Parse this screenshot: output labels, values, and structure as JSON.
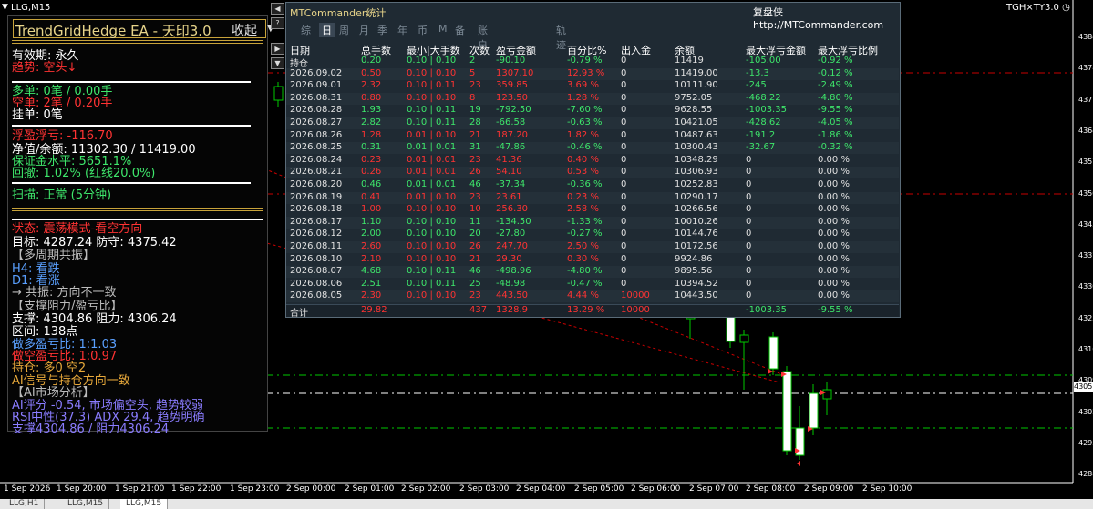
{
  "window": {
    "symbol_title": "LLG,M15",
    "right_indicator": "TGH×TY3.0"
  },
  "ea_panel": {
    "title": "TrendGridHedge EA - 天印3.0",
    "collapse_label": "收起",
    "lines": [
      {
        "text": "有效期: 永久",
        "color": "#ffffff"
      },
      {
        "text": "趋势: 空头↓",
        "color": "#ff3333"
      },
      {
        "text": "多单: 0笔 / 0.00手",
        "color": "#3ee66b"
      },
      {
        "text": "空单: 2笔 / 0.20手",
        "color": "#ff3333"
      },
      {
        "text": "挂单: 0笔",
        "color": "#ffffff"
      },
      {
        "text": "浮盈浮亏: -116.70",
        "color": "#ff3333"
      },
      {
        "text": "净值/余额: 11302.30 / 11419.00",
        "color": "#ffffff"
      },
      {
        "text": "保证金水平: 5651.1%",
        "color": "#3ee66b"
      },
      {
        "text": "回撤: 1.02% (红线20.0%)",
        "color": "#3ee66b"
      },
      {
        "text": "扫描: 正常 (5分钟)",
        "color": "#3ee66b"
      },
      {
        "text": "状态: 震荡模式-看空方向",
        "color": "#ff3333"
      },
      {
        "text": "目标: 4287.24  防守: 4375.42",
        "color": "#ffffff"
      },
      {
        "text": "【多周期共振】",
        "color": "#bbbbbb"
      },
      {
        "text": "H4: 看跌",
        "color": "#5aa0ff"
      },
      {
        "text": "D1: 看涨",
        "color": "#5aa0ff"
      },
      {
        "text": "→ 共振: 方向不一致",
        "color": "#bbbbbb"
      },
      {
        "text": "【支撑阻力/盈亏比】",
        "color": "#bbbbbb"
      },
      {
        "text": "支撑: 4304.86  阻力: 4306.24",
        "color": "#ffffff"
      },
      {
        "text": "区间: 138点",
        "color": "#ffffff"
      },
      {
        "text": "做多盈亏比: 1:1.03",
        "color": "#5aa0ff"
      },
      {
        "text": "做空盈亏比: 1:0.97",
        "color": "#ff3333"
      },
      {
        "text": "持仓: 多0 空2",
        "color": "#e7a83a"
      },
      {
        "text": "AI信号与持仓方向一致",
        "color": "#e7a83a"
      },
      {
        "text": "【AI市场分析】",
        "color": "#bbbbbb"
      },
      {
        "text": "AI评分 -0.54, 市场偏空头, 趋势较弱",
        "color": "#8a7cff"
      },
      {
        "text": "RSI中性(37.3)  ADX 29.4, 趋势明确",
        "color": "#8a7cff"
      },
      {
        "text": "支撑4304.86 / 阻力4306.24",
        "color": "#8a7cff"
      }
    ]
  },
  "side_buttons": [
    "◀",
    "?",
    "▶",
    "▼"
  ],
  "stats": {
    "title": "MTCommander统计",
    "brand": "复盘侠 http://MTCommander.com",
    "tabs": [
      "综",
      "日",
      "周",
      "月",
      "季",
      "年",
      "币",
      "M",
      "备",
      "账户",
      "轨迹"
    ],
    "active_tab": 1,
    "headers": [
      "日期",
      "总手数",
      "最小|大手数",
      "次数",
      "盈亏金额",
      "百分比%",
      "出入金",
      "余额",
      "最大浮亏金额",
      "最大浮亏比例"
    ],
    "rows": [
      [
        "持仓",
        "0.20",
        "0.10 | 0.10",
        "2",
        "-90.10",
        "-0.79 %",
        "0",
        "11419",
        "-105.00",
        "-0.92 %"
      ],
      [
        "2026.09.02",
        "0.50",
        "0.10 | 0.10",
        "5",
        "1307.10",
        "12.93 %",
        "0",
        "11419.00",
        "-13.3",
        "-0.12 %"
      ],
      [
        "2026.09.01",
        "2.32",
        "0.10 | 0.11",
        "23",
        "359.85",
        "3.69 %",
        "0",
        "10111.90",
        "-245",
        "-2.49 %"
      ],
      [
        "2026.08.31",
        "0.80",
        "0.10 | 0.10",
        "8",
        "123.50",
        "1.28 %",
        "0",
        "9752.05",
        "-468.22",
        "-4.80 %"
      ],
      [
        "2026.08.28",
        "1.93",
        "0.10 | 0.11",
        "19",
        "-792.50",
        "-7.60 %",
        "0",
        "9628.55",
        "-1003.35",
        "-9.55 %"
      ],
      [
        "2026.08.27",
        "2.82",
        "0.10 | 0.11",
        "28",
        "-66.58",
        "-0.63 %",
        "0",
        "10421.05",
        "-428.62",
        "-4.05 %"
      ],
      [
        "2026.08.26",
        "1.28",
        "0.01 | 0.10",
        "21",
        "187.20",
        "1.82 %",
        "0",
        "10487.63",
        "-191.2",
        "-1.86 %"
      ],
      [
        "2026.08.25",
        "0.31",
        "0.01 | 0.01",
        "31",
        "-47.86",
        "-0.46 %",
        "0",
        "10300.43",
        "-32.67",
        "-0.32 %"
      ],
      [
        "2026.08.24",
        "0.23",
        "0.01 | 0.01",
        "23",
        "41.36",
        "0.40 %",
        "0",
        "10348.29",
        "0",
        "0.00 %"
      ],
      [
        "2026.08.21",
        "0.26",
        "0.01 | 0.01",
        "26",
        "54.10",
        "0.53 %",
        "0",
        "10306.93",
        "0",
        "0.00 %"
      ],
      [
        "2026.08.20",
        "0.46",
        "0.01 | 0.01",
        "46",
        "-37.34",
        "-0.36 %",
        "0",
        "10252.83",
        "0",
        "0.00 %"
      ],
      [
        "2026.08.19",
        "0.41",
        "0.01 | 0.10",
        "23",
        "23.61",
        "0.23 %",
        "0",
        "10290.17",
        "0",
        "0.00 %"
      ],
      [
        "2026.08.18",
        "1.00",
        "0.10 | 0.10",
        "10",
        "256.30",
        "2.58 %",
        "0",
        "10266.56",
        "0",
        "0.00 %"
      ],
      [
        "2026.08.17",
        "1.10",
        "0.10 | 0.10",
        "11",
        "-134.50",
        "-1.33 %",
        "0",
        "10010.26",
        "0",
        "0.00 %"
      ],
      [
        "2026.08.12",
        "2.00",
        "0.10 | 0.10",
        "20",
        "-27.80",
        "-0.27 %",
        "0",
        "10144.76",
        "0",
        "0.00 %"
      ],
      [
        "2026.08.11",
        "2.60",
        "0.10 | 0.10",
        "26",
        "247.70",
        "2.50 %",
        "0",
        "10172.56",
        "0",
        "0.00 %"
      ],
      [
        "2026.08.10",
        "2.10",
        "0.10 | 0.10",
        "21",
        "29.30",
        "0.30 %",
        "0",
        "9924.86",
        "0",
        "0.00 %"
      ],
      [
        "2026.08.07",
        "4.68",
        "0.10 | 0.11",
        "46",
        "-498.96",
        "-4.80 %",
        "0",
        "9895.56",
        "0",
        "0.00 %"
      ],
      [
        "2026.08.06",
        "2.51",
        "0.10 | 0.11",
        "25",
        "-48.98",
        "-0.47 %",
        "0",
        "10394.52",
        "0",
        "0.00 %"
      ],
      [
        "2026.08.05",
        "2.30",
        "0.10 | 0.10",
        "23",
        "443.50",
        "4.44 %",
        "10000",
        "10443.50",
        "0",
        "0.00 %"
      ]
    ],
    "total": [
      "合计",
      "29.82",
      "",
      "437",
      "1328.9",
      "13.29 %",
      "10000",
      "",
      "-1003.35",
      "-9.55 %"
    ]
  },
  "x_axis": [
    "1 Sep 2026",
    "1 Sep 20:00",
    "1 Sep 21:00",
    "1 Sep 22:00",
    "1 Sep 23:00",
    "2 Sep 00:00",
    "2 Sep 01:00",
    "2 Sep 02:00",
    "2 Sep 03:00",
    "2 Sep 04:00",
    "2 Sep 05:00",
    "2 Sep 06:00",
    "2 Sep 07:00",
    "2 Sep 08:00",
    "2 Sep 09:00",
    "2 Sep 10:00"
  ],
  "y_axis": [
    "4384",
    "4378",
    "4371",
    "4364",
    "4357",
    "4350",
    "4343",
    "4337",
    "4330",
    "4323",
    "4316",
    "4309",
    "4302",
    "4295",
    "4288"
  ],
  "price_tag": "4305",
  "bottom_tabs": [
    "LLG,H1",
    "LLG,M15",
    "LLG,M15"
  ],
  "colors": {
    "bull": "#ffffff",
    "bear": "#000000",
    "line_green": "#00c800",
    "line_red": "#c80000"
  }
}
